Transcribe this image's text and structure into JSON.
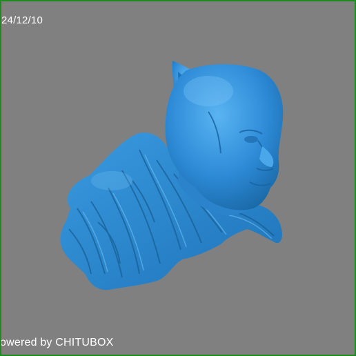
{
  "viewport": {
    "background_color": "#808080",
    "border_color": "#1f8a1f",
    "model_color": "#2f8fd6",
    "date_text": "24/12/10",
    "watermark_text": "owered by CHITUBOX"
  },
  "model": {
    "description_icon": "cat-mask-bust-3d-model"
  }
}
